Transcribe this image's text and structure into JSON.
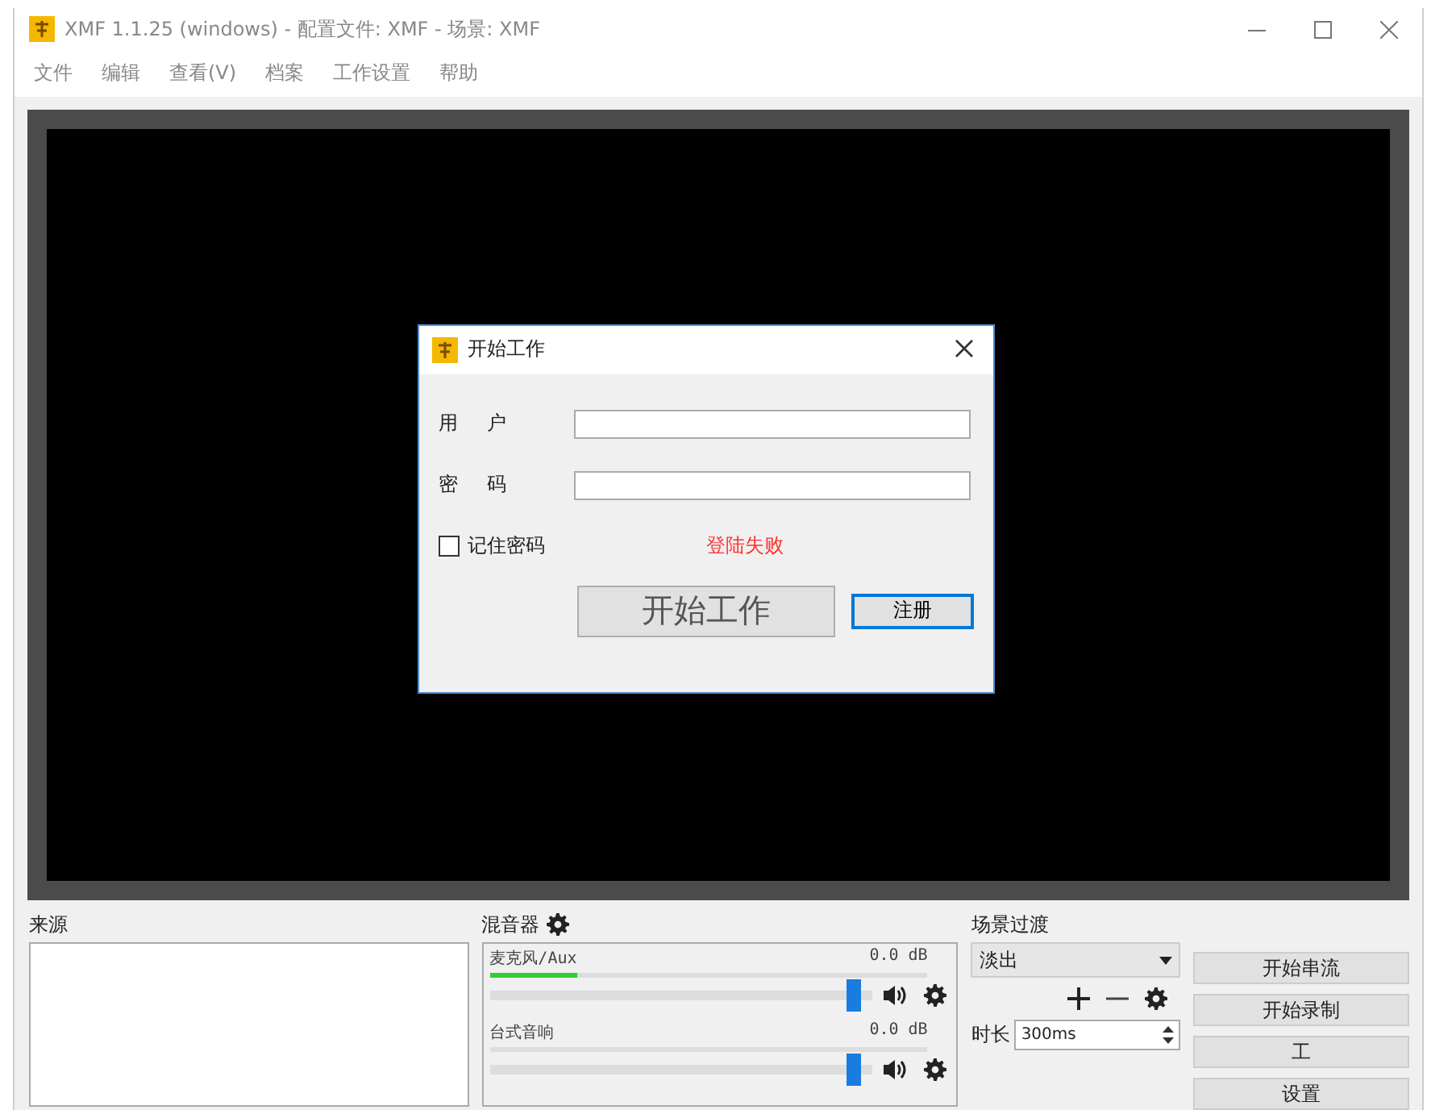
{
  "window": {
    "title": "XMF 1.1.25 (windows) - 配置文件: XMF - 场景: XMF"
  },
  "menu": [
    "文件",
    "编辑",
    "查看(V)",
    "档案",
    "工作设置",
    "帮助"
  ],
  "dialog": {
    "title": "开始工作",
    "fields": [
      {
        "label": "用 户"
      },
      {
        "label": "密 码"
      }
    ],
    "remember": {
      "label": "记住密码",
      "checked": false
    },
    "error": "登陆失败",
    "buttons": [
      {
        "label": "开始工作",
        "kind": "big"
      },
      {
        "label": "注册",
        "kind": "default"
      }
    ]
  },
  "sources": {
    "title": "来源"
  },
  "mixer": {
    "title": "混音器",
    "channels": [
      {
        "name": "麦克风/Aux",
        "reading": "0.0 dB",
        "meter": {
          "level": 0.2
        },
        "volume": {
          "level": 0.97
        }
      },
      {
        "name": "台式音响",
        "reading": "0.0 dB",
        "volume": {
          "level": 0.97
        }
      }
    ]
  },
  "transitions": {
    "title": "场景过渡",
    "select": "淡出",
    "duration_label": "时长",
    "duration": "300ms"
  },
  "controls": [
    "开始串流",
    "开始录制",
    "工",
    "设置"
  ]
}
